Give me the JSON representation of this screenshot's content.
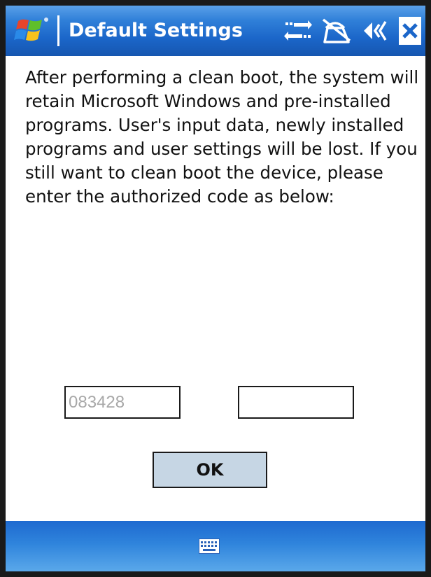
{
  "window": {
    "title": "Default Settings"
  },
  "message": "After performing a clean boot, the system will retain Microsoft Windows and pre-installed programs. User's input data, newly installed programs and user settings will be lost. If you still want to clean boot the device, please enter the authorized code as below:",
  "code_fields": {
    "authorized_code_placeholder": "083428",
    "entry_value": ""
  },
  "buttons": {
    "ok_label": "OK"
  },
  "icons": {
    "start": "windows-start-icon",
    "connectivity": "connectivity-icon",
    "phone": "phone-off-icon",
    "volume": "volume-icon",
    "close": "close-icon",
    "keyboard": "keyboard-icon"
  },
  "colors": {
    "titlebar": "#1b66c9",
    "button_face": "#c6d6e4",
    "placeholder_text": "#a8a8a8",
    "frame": "#1a1a1a"
  }
}
